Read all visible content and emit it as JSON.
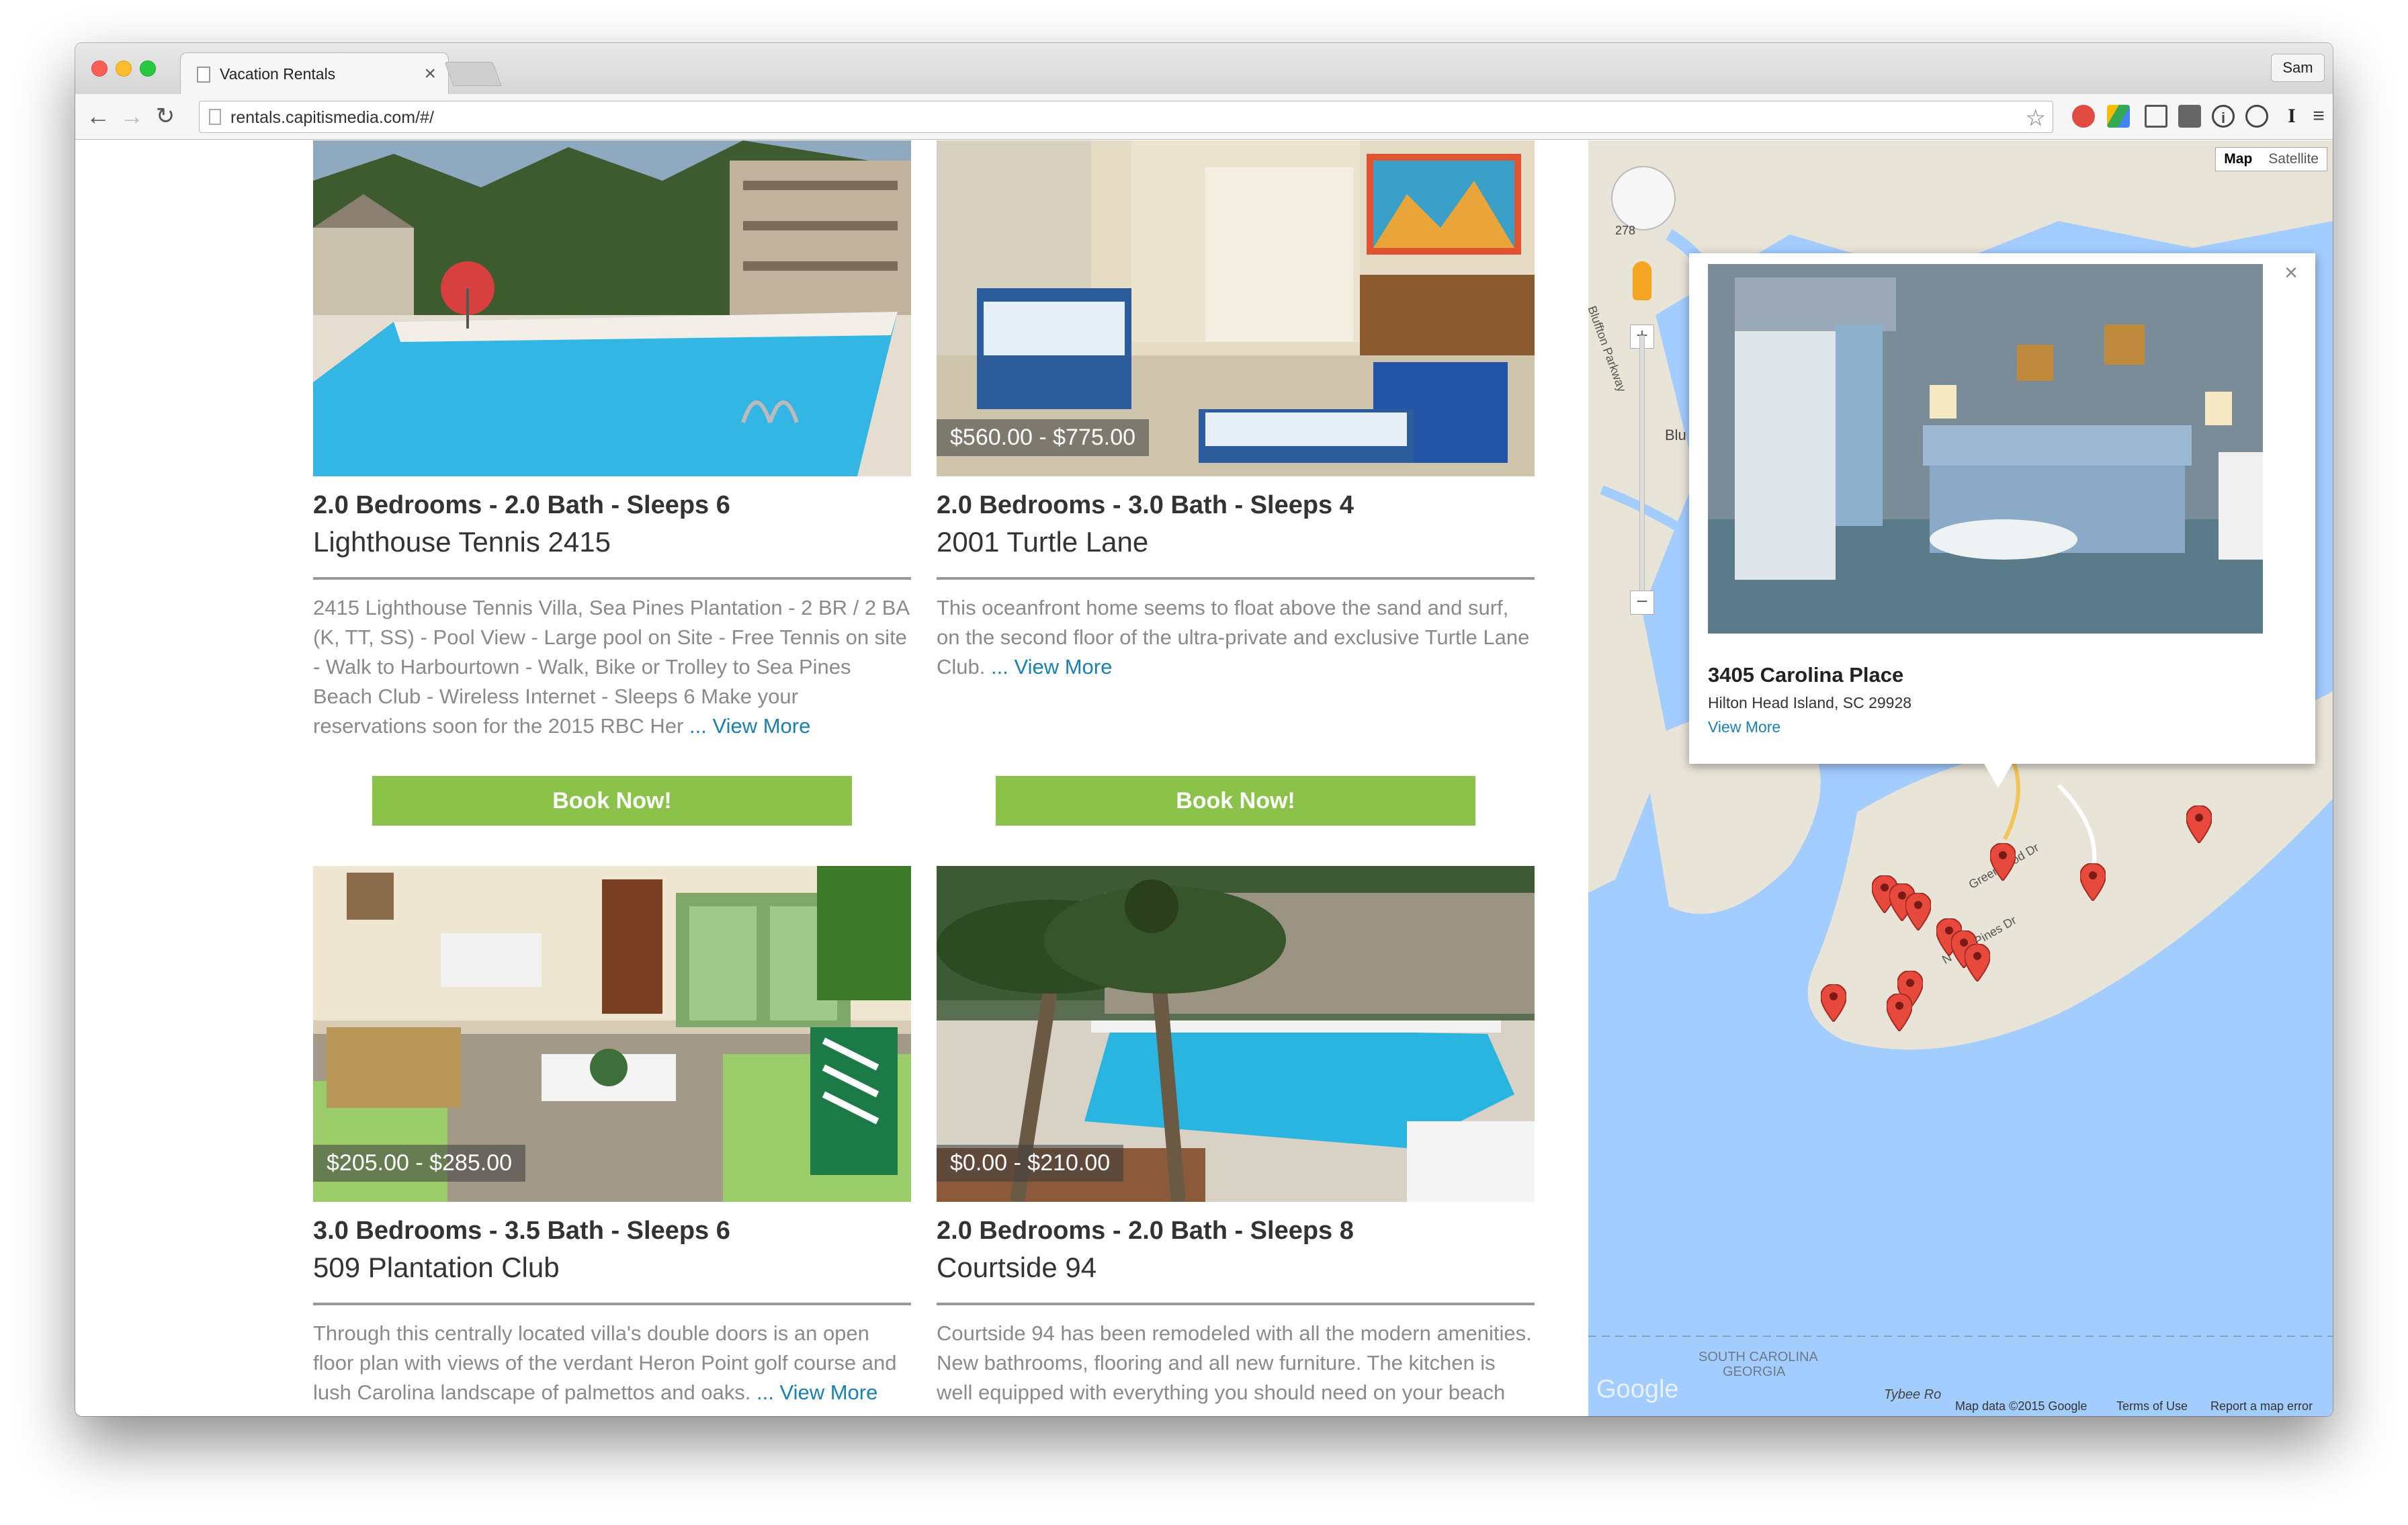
{
  "browser": {
    "tab_title": "Vacation Rentals",
    "tab_close": "×",
    "profile_name": "Sam",
    "url": "rentals.capitismedia.com/#/"
  },
  "listings": [
    {
      "rooms": "2.0 Bedrooms - 2.0 Bath - Sleeps 6",
      "name": "Lighthouse Tennis 2415",
      "price": "",
      "description": "2415 Lighthouse Tennis Villa, Sea Pines Plantation - 2 BR / 2 BA (K, TT, SS) - Pool View - Large pool on Site - Free Tennis on site - Walk to Harbourtown - Walk, Bike or Trolley to Sea Pines Beach Club - Wireless Internet - Sleeps 6 Make your reservations soon for the 2015 RBC Her",
      "view_more": "... View More",
      "book_label": "Book Now!"
    },
    {
      "rooms": "2.0 Bedrooms - 3.0 Bath - Sleeps 4",
      "name": "2001 Turtle Lane",
      "price": "$560.00 - $775.00",
      "description": "This oceanfront home seems to float above the sand and surf, on the second floor of the ultra-private and exclusive Turtle Lane Club.",
      "view_more": "... View More",
      "book_label": "Book Now!"
    },
    {
      "rooms": "3.0 Bedrooms - 3.5 Bath - Sleeps 6",
      "name": "509 Plantation Club",
      "price": "$205.00 - $285.00",
      "description": "Through this centrally located villa's double doors is an open floor plan with views of the verdant Heron Point golf course and lush Carolina landscape of palmettos and oaks.",
      "view_more": "... View More"
    },
    {
      "rooms": "2.0 Bedrooms - 2.0 Bath - Sleeps 8",
      "name": "Courtside 94",
      "price": "$0.00 - $210.00",
      "description": "Courtside 94 has been remodeled with all the modern amenities. New bathrooms, flooring and all new furniture. The kitchen is well equipped with everything you should need on your beach",
      "view_more": ""
    }
  ],
  "map": {
    "type_map": "Map",
    "type_satellite": "Satellite",
    "popup": {
      "title": "3405 Carolina Place",
      "address": "Hilton Head Island, SC 29928",
      "link": "View More",
      "close": "×"
    },
    "labels": {
      "route_278": "278",
      "bluffton_parkway": "Bluffton Parkway",
      "blu": "Blu",
      "greenwood": "Greenwood Dr",
      "sea_pines": "N Sea Pines Dr",
      "state_line_sc": "SOUTH CAROLINA",
      "state_line_ga": "GEORGIA",
      "tybee": "Tybee Ro",
      "google": "Google"
    },
    "footer": {
      "data": "Map data ©2015 Google",
      "terms": "Terms of Use",
      "report": "Report a map error"
    },
    "water_color": "#a3ccff",
    "land_color": "#e8e4d8",
    "accent_button": "#8bc34a",
    "link_color": "#1a7fb3"
  }
}
